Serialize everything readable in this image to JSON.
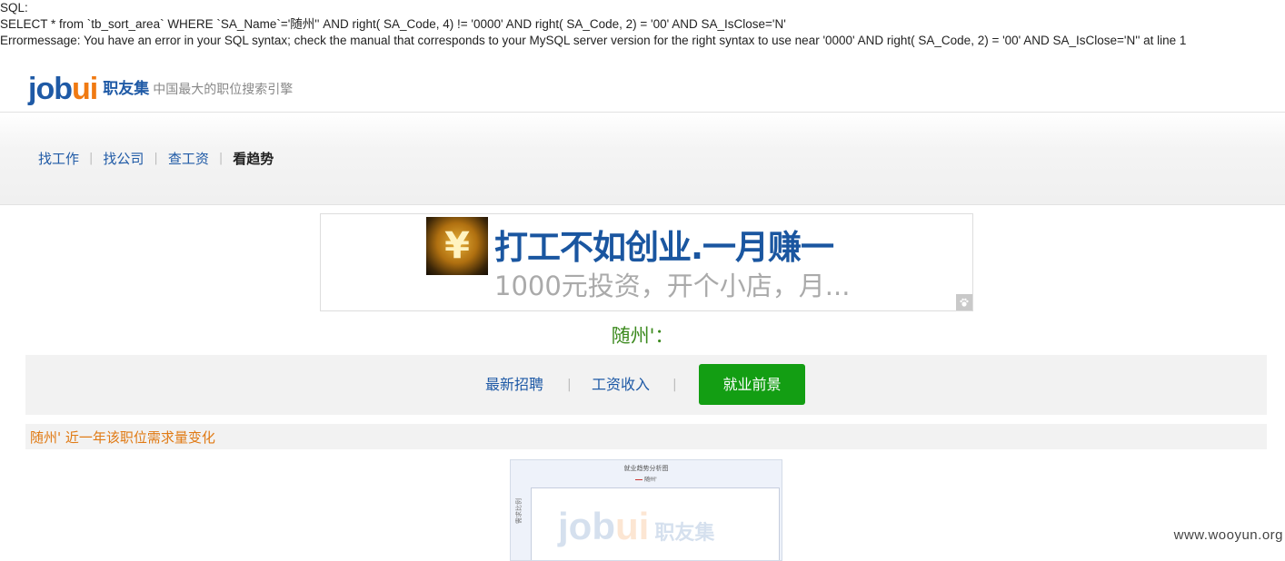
{
  "sql_error": {
    "label_line": "SQL:",
    "query_line": "SELECT * from `tb_sort_area` WHERE `SA_Name`='随州'' AND right( SA_Code, 4) != '0000' AND right( SA_Code, 2) = '00' AND SA_IsClose='N'",
    "error_line": "Errormessage: You have an error in your SQL syntax; check the manual that corresponds to your MySQL server version for the right syntax to use near '0000' AND right( SA_Code, 2) = '00' AND SA_IsClose='N'' at line 1"
  },
  "logo": {
    "mark_job": "job",
    "mark_ui": "ui",
    "name_cn": "职友集",
    "slogan": "中国最大的职位搜索引擎"
  },
  "nav": {
    "items": [
      {
        "label": "找工作"
      },
      {
        "label": "找公司"
      },
      {
        "label": "查工资"
      },
      {
        "label": "看趋势"
      }
    ],
    "separator": "|"
  },
  "ad": {
    "icon_symbol": "¥",
    "title": "打工不如创业.一月赚一",
    "subtitle": "1000元投资，开个小店，月...",
    "badge_icon": "paw-icon"
  },
  "city_title": "随州'：",
  "tabs": {
    "items": [
      {
        "label": "最新招聘"
      },
      {
        "label": "工资收入"
      },
      {
        "label": "就业前景"
      }
    ],
    "separator": "|"
  },
  "section": {
    "title": "随州' 近一年该职位需求量变化"
  },
  "chart": {
    "title": "就业趋势分析图",
    "legend": "随州'",
    "ylabel": "需求比例",
    "watermark_job": "job",
    "watermark_ui": "ui",
    "watermark_cn": "职友集"
  },
  "footer": {
    "watermark": "www.wooyun.org"
  },
  "colors": {
    "brand_blue": "#1f5aa6",
    "brand_orange": "#f07a12",
    "active_tab_green": "#139e13",
    "city_green": "#3c8a1e",
    "section_orange": "#e07a14"
  }
}
